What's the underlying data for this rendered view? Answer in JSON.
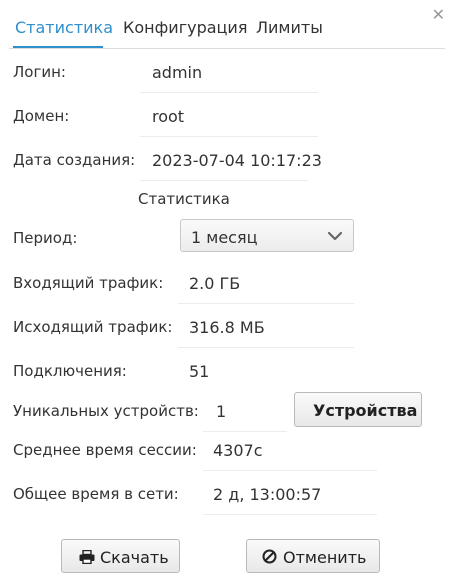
{
  "tabs": [
    {
      "label": "Статистика",
      "active": true
    },
    {
      "label": "Конфигурация",
      "active": false
    },
    {
      "label": "Лимиты",
      "active": false
    }
  ],
  "close_icon": "close-icon",
  "info": {
    "login_label": "Логин:",
    "login_value": "admin",
    "domain_label": "Домен:",
    "domain_value": "root",
    "created_label": "Дата создания:",
    "created_value": "2023-07-04 10:17:23"
  },
  "stats": {
    "heading": "Статистика",
    "period_label": "Период:",
    "period_value": "1 месяц",
    "incoming_label": "Входящий трафик:",
    "incoming_value": "2.0 ГБ",
    "outgoing_label": "Исходящий трафик:",
    "outgoing_value": "316.8 МБ",
    "connections_label": "Подключения:",
    "connections_value": "51",
    "devices_label": "Уникальных устройств:",
    "devices_value": "1",
    "devices_button": "Устройства",
    "avg_session_label": "Среднее время сессии:",
    "avg_session_value": "4307с",
    "total_online_label": "Общее время в сети:",
    "total_online_value": "2 д, 13:00:57"
  },
  "footer": {
    "download_label": "Скачать",
    "cancel_label": "Отменить"
  },
  "colors": {
    "accent": "#2f8fcb"
  },
  "icons": {
    "download": "printer-icon",
    "cancel": "cancel-circle-icon",
    "select": "chevron-down-icon"
  }
}
